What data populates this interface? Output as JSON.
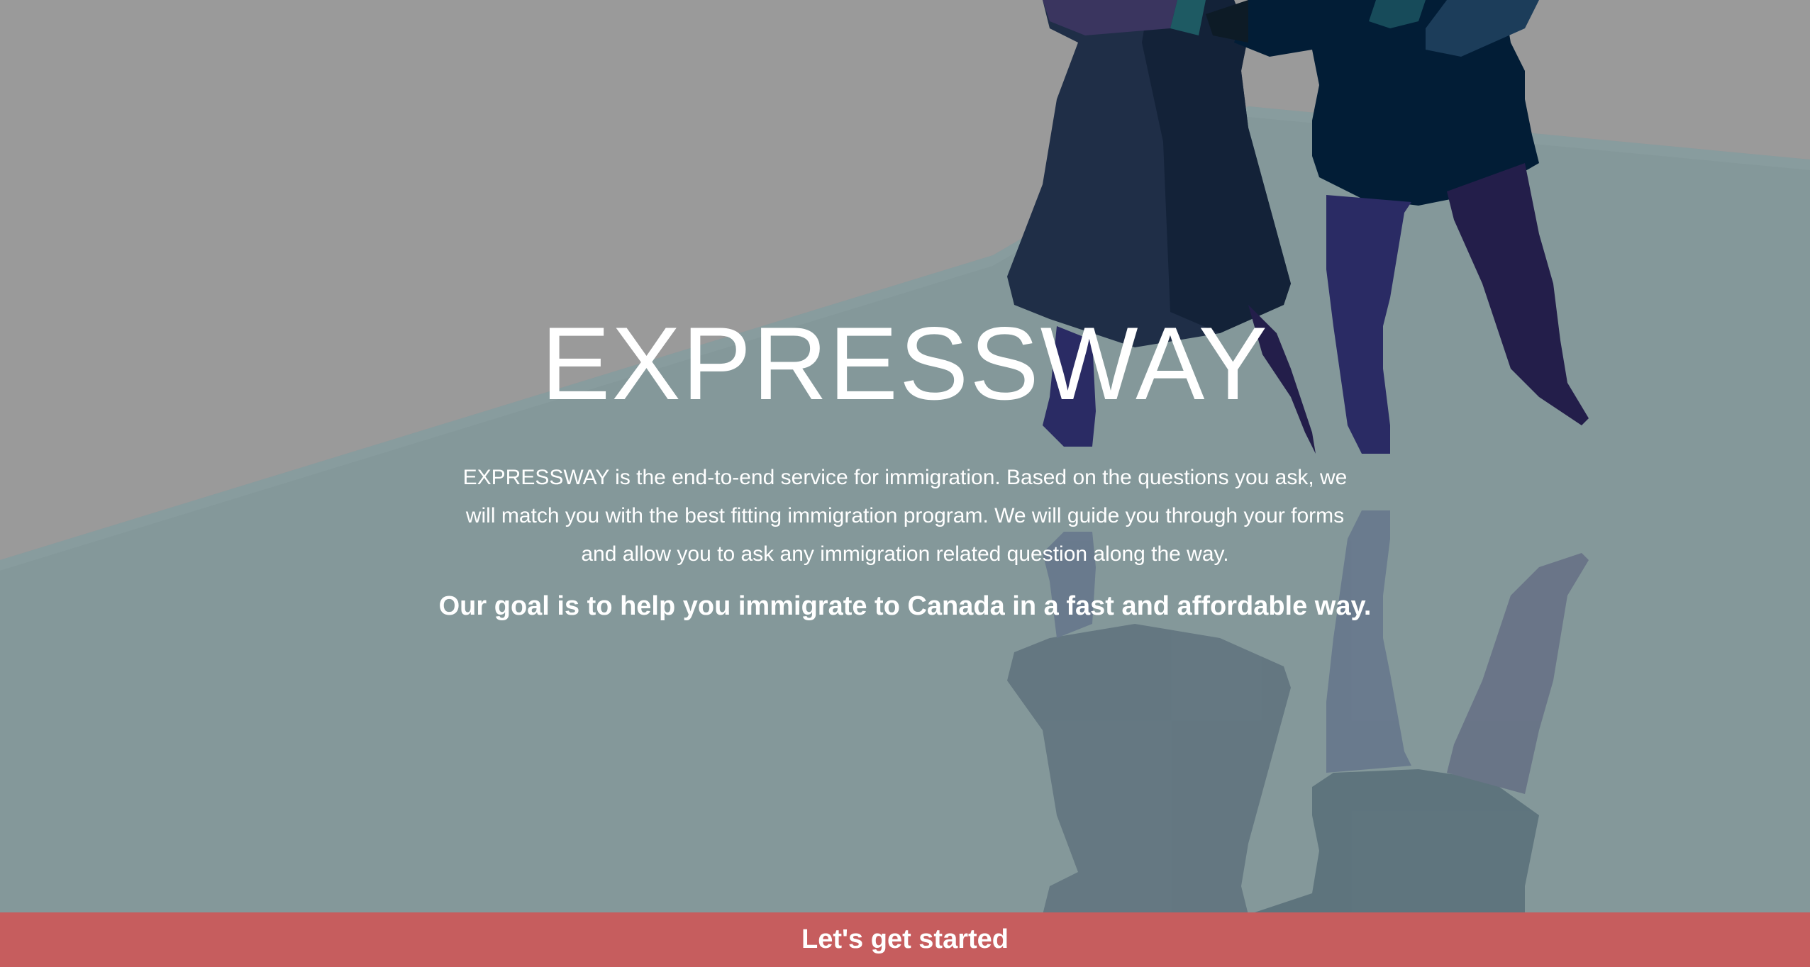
{
  "hero": {
    "title": "EXPRESSWAY",
    "description": "EXPRESSWAY is the end-to-end service for immigration. Based on the questions you ask, we will match you with the best fitting immigration program. We will guide you through your forms and allow you to ask any immigration related question along the way.",
    "goal": "Our goal is to help you immigrate to Canada in a fast and affordable way."
  },
  "cta": {
    "label": "Let's get started"
  },
  "colors": {
    "overlay_gray": "#9a9a9a",
    "floor_teal": "#84989a",
    "cta_red": "#c65d5e",
    "text": "#ffffff"
  }
}
